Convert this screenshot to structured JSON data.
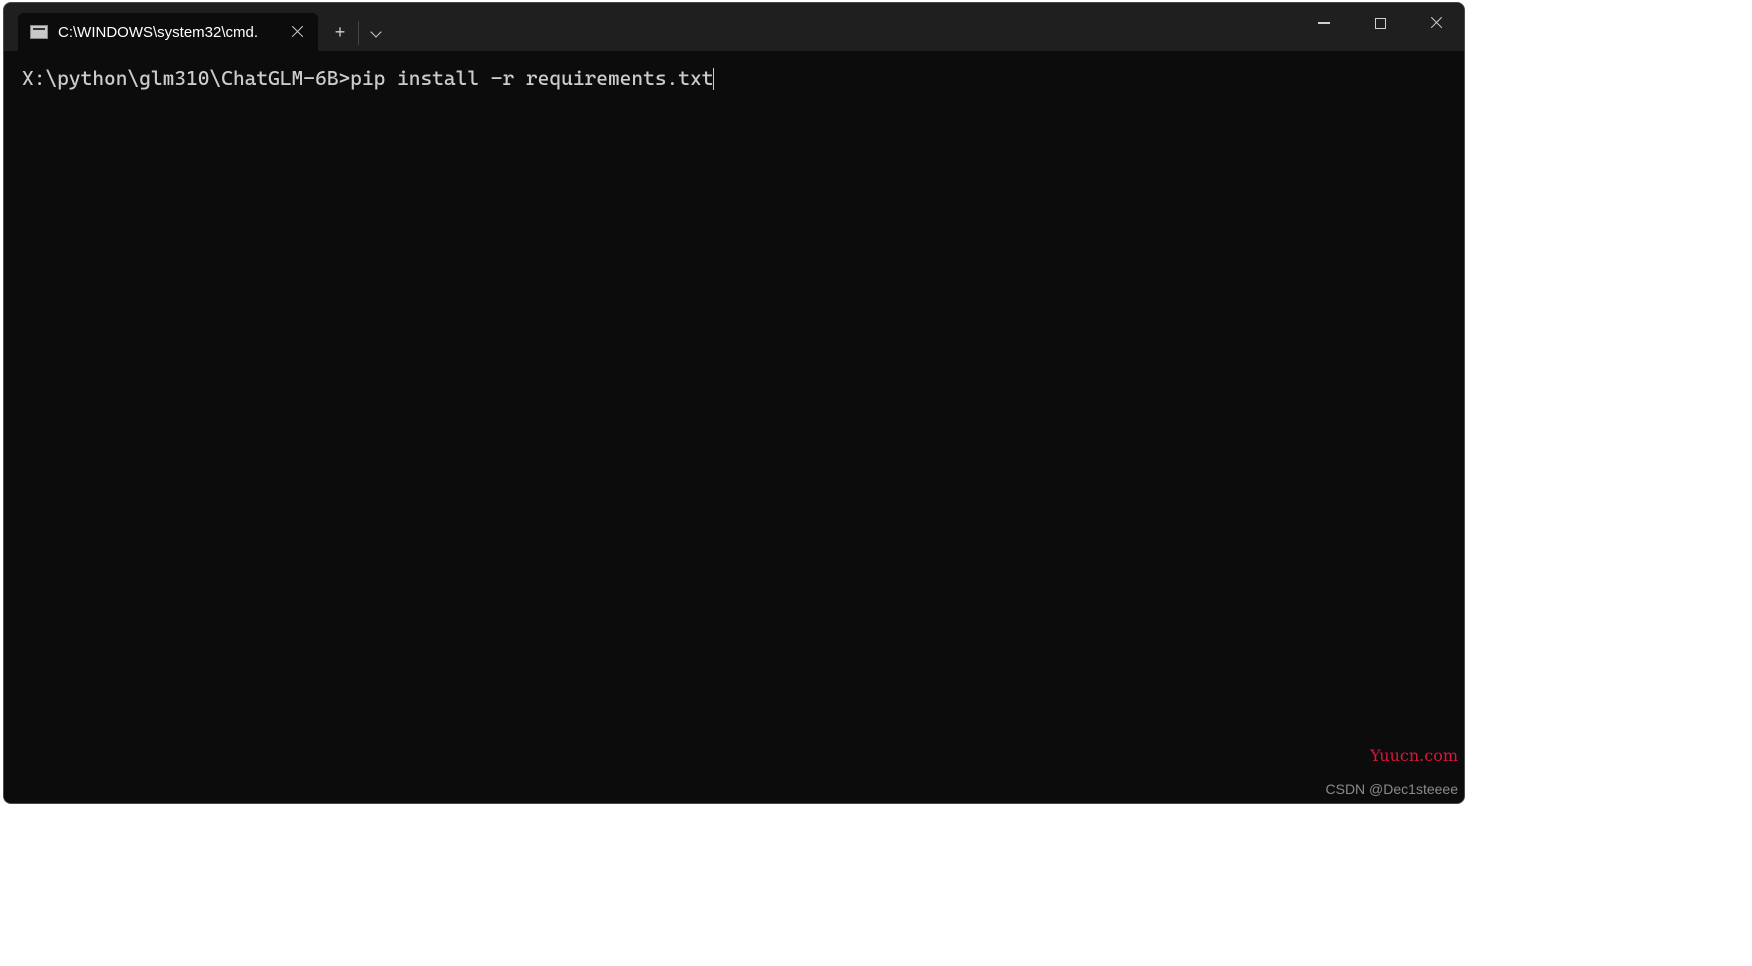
{
  "tab": {
    "title": "C:\\WINDOWS\\system32\\cmd."
  },
  "terminal": {
    "prompt": "X:\\python\\glm310\\ChatGLM-6B>",
    "command": "pip install -r requirements.txt"
  },
  "watermarks": {
    "site": "Yuucn.com",
    "author": "CSDN @Dec1steeee"
  }
}
